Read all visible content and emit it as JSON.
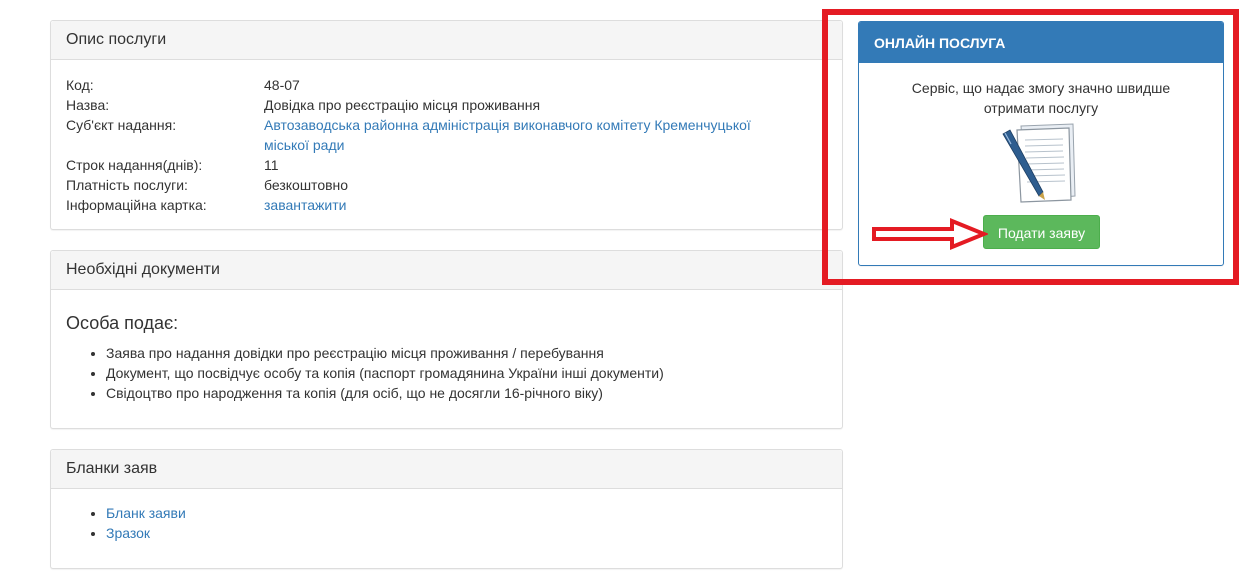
{
  "description": {
    "heading": "Опис послуги",
    "rows": [
      {
        "label": "Код:",
        "value": "48-07"
      },
      {
        "label": "Назва:",
        "value": "Довідка про реєстрацію місця проживання"
      },
      {
        "label": "Суб'єкт надання:",
        "value": "Автозаводська районна адміністрація виконавчого комітету Кременчуцької міської ради"
      },
      {
        "label": "Строк надання(днів):",
        "value": "11"
      },
      {
        "label": "Платність послуги:",
        "value": "безкоштовно"
      },
      {
        "label": "Інформаційна картка:",
        "value": "завантажити"
      }
    ]
  },
  "documents": {
    "heading": "Необхідні документи",
    "subheading": "Особа подає:",
    "items": [
      "Заява про надання довідки про реєстрацію місця проживання / перебування",
      "Документ, що посвідчує особу та копія (паспорт громадянина України інші документи)",
      "Свідоцтво про народження та копія (для осіб, що не досягли 16-річного віку)"
    ]
  },
  "forms": {
    "heading": "Бланки заяв",
    "items": [
      "Бланк заяви",
      "Зразок"
    ]
  },
  "online": {
    "heading": "ОНЛАЙН ПОСЛУГА",
    "text": "Сервіс, що надає змогу значно швидше отримати послугу",
    "icon": "document-pen-icon",
    "button_label": "Подати заяву"
  },
  "colors": {
    "accent": "#337ab7",
    "button": "#5cb85c",
    "highlight": "#e41b23"
  }
}
